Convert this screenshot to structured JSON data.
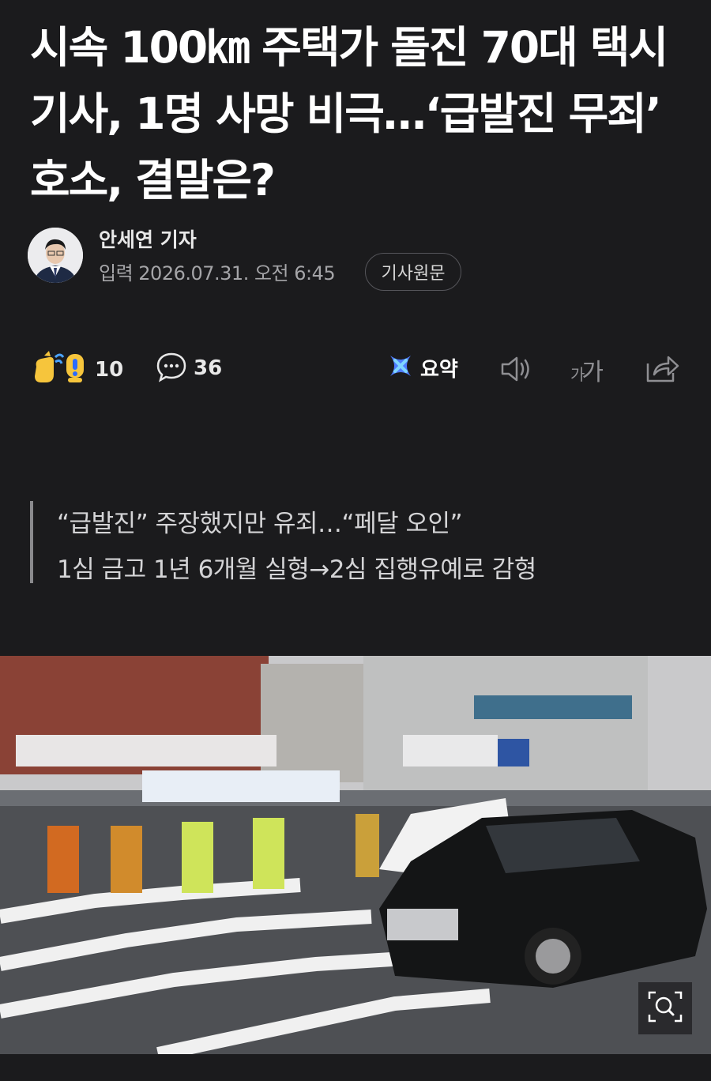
{
  "article": {
    "headline": "시속 100㎞ 주택가 돌진 70대 택시기사, 1명 사망 비극…‘급발진 무죄’ 호소, 결말은?",
    "author": "안세연 기자",
    "timestamp": "입력 2026.07.31. 오전 6:45",
    "original_button": "기사원문",
    "subtitle_lines": [
      "“급발진” 주장했지만 유죄…“페달 오인”",
      "1심 금고 1년 6개월 실형→2심 집행유예로 감형"
    ]
  },
  "actions": {
    "reaction_count": "10",
    "comment_count": "36",
    "summary_label": "요약",
    "font_size_label_small": "가",
    "font_size_label_large": "가"
  },
  "icons": {
    "reaction": "clap-surprise-emoji-icon",
    "comment": "speech-bubble-icon",
    "summary": "ai-summary-icon",
    "tts": "speaker-icon",
    "share": "share-icon",
    "zoom": "zoom-search-icon"
  },
  "colors": {
    "background": "#1b1b1d",
    "summary_accent": "#4d7cff"
  }
}
